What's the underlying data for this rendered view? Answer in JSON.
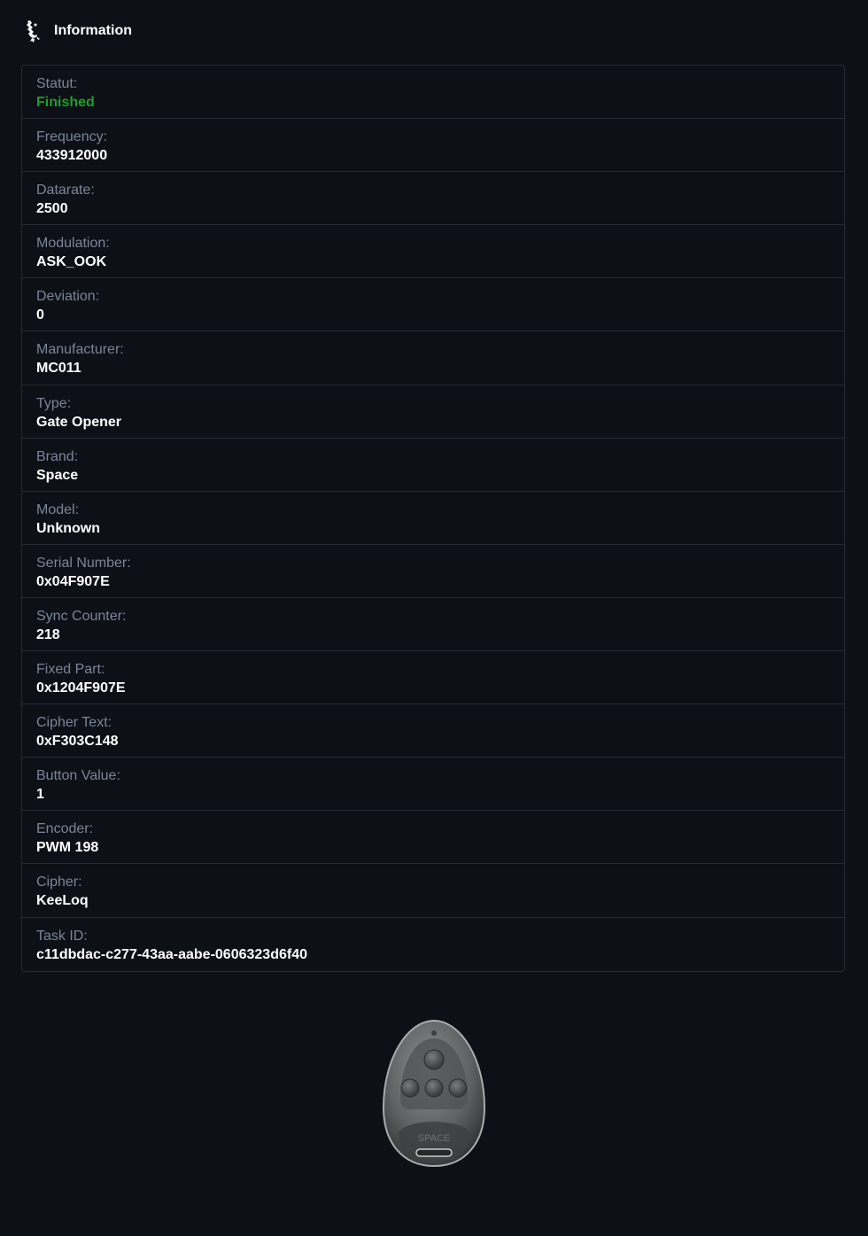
{
  "header": {
    "title": "Information",
    "icon": "bird-logo-icon"
  },
  "colors": {
    "background": "#0d1017",
    "border": "#262a33",
    "label": "#7b8598",
    "value": "#ffffff",
    "status_finished": "#1f9d2b"
  },
  "info": {
    "rows": [
      {
        "label": "Statut:",
        "value": "Finished"
      },
      {
        "label": "Frequency:",
        "value": "433912000"
      },
      {
        "label": "Datarate:",
        "value": "2500"
      },
      {
        "label": "Modulation:",
        "value": "ASK_OOK"
      },
      {
        "label": "Deviation:",
        "value": "0"
      },
      {
        "label": "Manufacturer:",
        "value": "MC011"
      },
      {
        "label": "Type:",
        "value": "Gate Opener"
      },
      {
        "label": "Brand:",
        "value": "Space"
      },
      {
        "label": "Model:",
        "value": "Unknown"
      },
      {
        "label": "Serial Number:",
        "value": "0x04F907E"
      },
      {
        "label": "Sync Counter:",
        "value": "218"
      },
      {
        "label": "Fixed Part:",
        "value": "0x1204F907E"
      },
      {
        "label": "Cipher Text:",
        "value": "0xF303C148"
      },
      {
        "label": "Button Value:",
        "value": "1"
      },
      {
        "label": "Encoder:",
        "value": "PWM 198"
      },
      {
        "label": "Cipher:",
        "value": "KeeLoq"
      },
      {
        "label": "Task ID:",
        "value": "c11dbdac-c277-43aa-aabe-0606323d6f40"
      }
    ]
  },
  "remote": {
    "brand_text": "SPACE",
    "icon": "remote-control-icon"
  }
}
